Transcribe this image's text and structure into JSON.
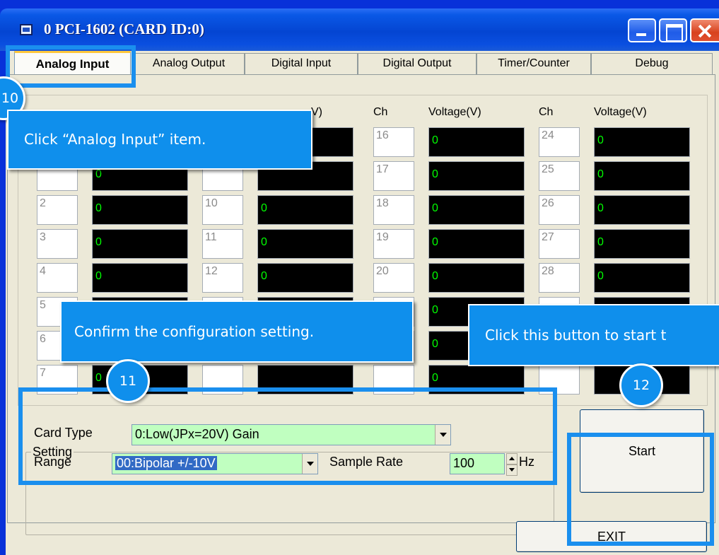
{
  "window": {
    "title": "0 PCI-1602 (CARD ID:0)"
  },
  "tabs": [
    {
      "label": "Analog Input",
      "mnemonic": "I"
    },
    {
      "label": "Analog Output",
      "mnemonic": "O"
    },
    {
      "label": "Digital Input",
      "mnemonic": "I"
    },
    {
      "label": "Digital Output",
      "mnemonic": "D"
    },
    {
      "label": "Timer/Counter",
      "mnemonic": "C"
    },
    {
      "label": "Debug"
    }
  ],
  "columns": {
    "ch_header": "Ch",
    "voltage_header": "Voltage(V)",
    "voltage_header_partial": "V)"
  },
  "channels": {
    "col1": [
      {
        "ch": "",
        "v": ""
      },
      {
        "ch": "",
        "v": "0"
      },
      {
        "ch": "2",
        "v": "0"
      },
      {
        "ch": "3",
        "v": "0"
      },
      {
        "ch": "4",
        "v": "0"
      },
      {
        "ch": "5",
        "v": ""
      },
      {
        "ch": "6",
        "v": ""
      },
      {
        "ch": "7",
        "v": "0"
      }
    ],
    "col2": [
      {
        "ch": "",
        "v": ""
      },
      {
        "ch": "",
        "v": ""
      },
      {
        "ch": "10",
        "v": "0"
      },
      {
        "ch": "11",
        "v": "0"
      },
      {
        "ch": "12",
        "v": "0"
      },
      {
        "ch": "",
        "v": ""
      },
      {
        "ch": "",
        "v": ""
      },
      {
        "ch": "",
        "v": ""
      }
    ],
    "col3": [
      {
        "ch": "16",
        "v": "0"
      },
      {
        "ch": "17",
        "v": "0"
      },
      {
        "ch": "18",
        "v": "0"
      },
      {
        "ch": "19",
        "v": "0"
      },
      {
        "ch": "20",
        "v": "0"
      },
      {
        "ch": "",
        "v": "0"
      },
      {
        "ch": "",
        "v": "0"
      },
      {
        "ch": "",
        "v": "0"
      }
    ],
    "col4": [
      {
        "ch": "24",
        "v": "0"
      },
      {
        "ch": "25",
        "v": "0"
      },
      {
        "ch": "26",
        "v": "0"
      },
      {
        "ch": "27",
        "v": "0"
      },
      {
        "ch": "28",
        "v": "0"
      },
      {
        "ch": "",
        "v": ""
      },
      {
        "ch": "",
        "v": ""
      },
      {
        "ch": "",
        "v": ""
      }
    ]
  },
  "setting": {
    "legend": "Setting",
    "card_type_label": "Card Type",
    "card_type_value": "0:Low(JPx=20V) Gain",
    "range_label": "Range",
    "range_value": "00:Bipolar +/-10V",
    "sample_rate_label": "Sample Rate",
    "sample_rate_value": "100",
    "sample_rate_unit": "Hz"
  },
  "buttons": {
    "start": "Start",
    "exit": "EXIT"
  },
  "annotations": {
    "step10_badge": "10",
    "step10_text": "Click “Analog Input” item.",
    "step11_badge": "11",
    "step11_text": "Confirm the configuration setting.",
    "step12_badge": "12",
    "step12_text": "Click this button to start t"
  },
  "colors": {
    "callout_blue": "#0f8fec",
    "voltage_text": "#00ff00",
    "field_green": "#c0ffc0"
  }
}
